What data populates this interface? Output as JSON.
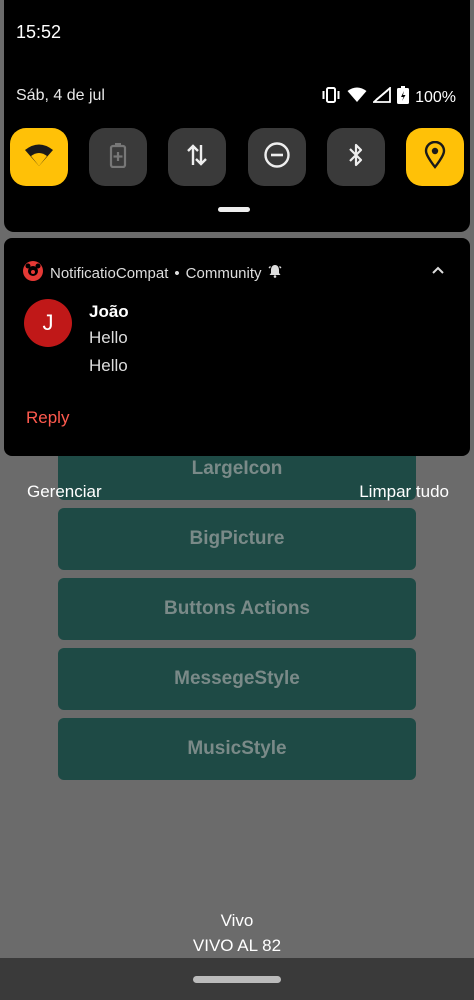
{
  "status_bar": {
    "time": "15:52",
    "date": "Sáb, 4 de jul",
    "battery": "100%"
  },
  "quick_tiles": [
    {
      "name": "wifi-tile",
      "icon": "wifi-icon",
      "on": true
    },
    {
      "name": "battery-saver-tile",
      "icon": "battery-icon",
      "on": false
    },
    {
      "name": "mobile-data-tile",
      "icon": "data-arrows-icon",
      "on": false
    },
    {
      "name": "dnd-tile",
      "icon": "minus-circle-icon",
      "on": false
    },
    {
      "name": "bluetooth-tile",
      "icon": "bluetooth-icon",
      "on": false
    },
    {
      "name": "location-tile",
      "icon": "location-icon",
      "on": true
    }
  ],
  "notification": {
    "app": "NotificatioCompat",
    "separator": "•",
    "channel": "Community",
    "avatar_letter": "J",
    "sender": "João",
    "messages": [
      "Hello",
      "Hello"
    ],
    "action": "Reply"
  },
  "shade_actions": {
    "manage": "Gerenciar",
    "clear_all": "Limpar tudo"
  },
  "background_buttons": [
    "LargeIcon",
    "BigPicture",
    "Buttons Actions",
    "MessegeStyle",
    "MusicStyle"
  ],
  "carrier": {
    "line1": "Vivo",
    "line2": "VIVO AL 82"
  },
  "colors": {
    "tile_on": "#ffc107",
    "accent_red": "#ff5a4e",
    "app_button": "#1e4a45"
  }
}
